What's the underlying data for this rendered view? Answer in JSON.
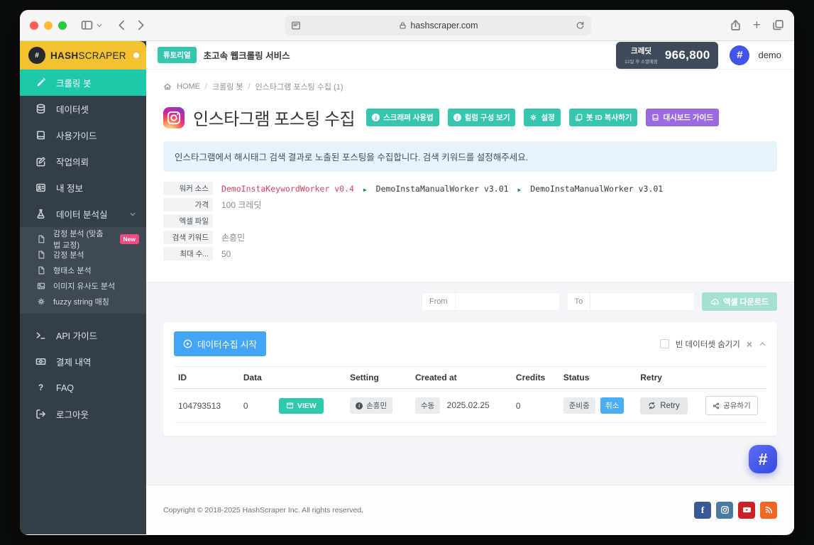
{
  "browser": {
    "url": "hashscraper.com"
  },
  "topbar": {
    "tutorial_badge": "튜토리얼",
    "tagline": "초고속 웹크롤링 서비스",
    "credit": {
      "label": "크레딧",
      "expiry": "12일 후 소멸예정",
      "amount": "966,800"
    },
    "user": {
      "name": "demo",
      "avatar_glyph": "#"
    }
  },
  "sidebar": {
    "logo": {
      "bold": "HASH",
      "light": "SCRAPER",
      "mark_glyph": "#"
    },
    "items": [
      {
        "label": "크롤링 봇"
      },
      {
        "label": "데이터셋"
      },
      {
        "label": "사용가이드"
      },
      {
        "label": "작업의뢰"
      },
      {
        "label": "내 정보"
      },
      {
        "label": "데이터 분석실"
      }
    ],
    "analysis_subitems": [
      {
        "label": "감정 분석 (맞춤법 교정)",
        "badge": "New"
      },
      {
        "label": "감정 분석"
      },
      {
        "label": "형태소 분석"
      },
      {
        "label": "이미지 유사도 분석"
      },
      {
        "label": "fuzzy string 매칭"
      }
    ],
    "bottom_items": [
      {
        "label": "API 가이드"
      },
      {
        "label": "결제 내역"
      },
      {
        "label": "FAQ"
      },
      {
        "label": "로그아웃"
      }
    ]
  },
  "breadcrumb": {
    "home": "HOME",
    "section": "크롤링 봇",
    "current": "인스타그램 포스팅 수집 (1)"
  },
  "page": {
    "title": "인스타그램 포스팅 수집",
    "actions": {
      "usage": "스크래퍼 사용법",
      "columns": "컬럼 구성 보기",
      "settings": "설정",
      "copy_bot_id": "봇 ID 복사하기",
      "dashboard_guide": "대시보드 가이드"
    },
    "alert": "인스타그램에서 해시태그 검색 결과로 노출된 포스팅을 수집합니다. 검색 키워드를 설정해주세요.",
    "details": {
      "worker_label": "워커 소스",
      "worker_link": "DemoInstaKeywordWorker v0.4",
      "worker_v2": "DemoInstaManualWorker v3.01",
      "worker_v3": "DemoInstaManualWorker v3.01",
      "price_label": "가격",
      "price": "100 크레딧",
      "excel_label": "엑셀 파일",
      "keyword_label": "검색 키워드",
      "keyword": "손흥민",
      "max_label": "최대 수...",
      "max": "50"
    }
  },
  "filterbar": {
    "from": "From",
    "to": "To",
    "excel_download": "엑셀 다운로드"
  },
  "collection": {
    "start_button": "데이터수집 시작",
    "hide_empty_label": "빈 데이터셋 숨기기",
    "table": {
      "headers": {
        "id": "ID",
        "data": "Data",
        "setting": "Setting",
        "created": "Created at",
        "credits": "Credits",
        "status": "Status",
        "retry": "Retry"
      },
      "row": {
        "id": "104793513",
        "data": "0",
        "view": "VIEW",
        "setting": "손흥민",
        "created_badge": "수동",
        "created_date": "2025.02.25",
        "credits": "0",
        "status_ready": "준비중",
        "status_cancel": "취소",
        "retry": "Retry",
        "share": "공유하기"
      }
    }
  },
  "footer": {
    "copyright": "Copyright © 2018-2025 HashScraper Inc. All rights reserved."
  },
  "icons": {
    "plus": "+",
    "question": "?",
    "hash": "#",
    "facebook": "f",
    "worker_arrow": "▶",
    "close": "×",
    "info": "i"
  },
  "colors": {
    "accent_teal": "#36c6ad",
    "active_teal": "#1fc8a9",
    "accent_purple": "#9b6ae1",
    "accent_blue": "#42a5f5",
    "sidebar_yellow": "#f2c230",
    "sidebar_dark": "#343e48",
    "credit_dark": "#3d4a58",
    "avatar_blue": "#4355e8",
    "link_red": "#d6455c",
    "cancel_blue": "#49aef3"
  }
}
